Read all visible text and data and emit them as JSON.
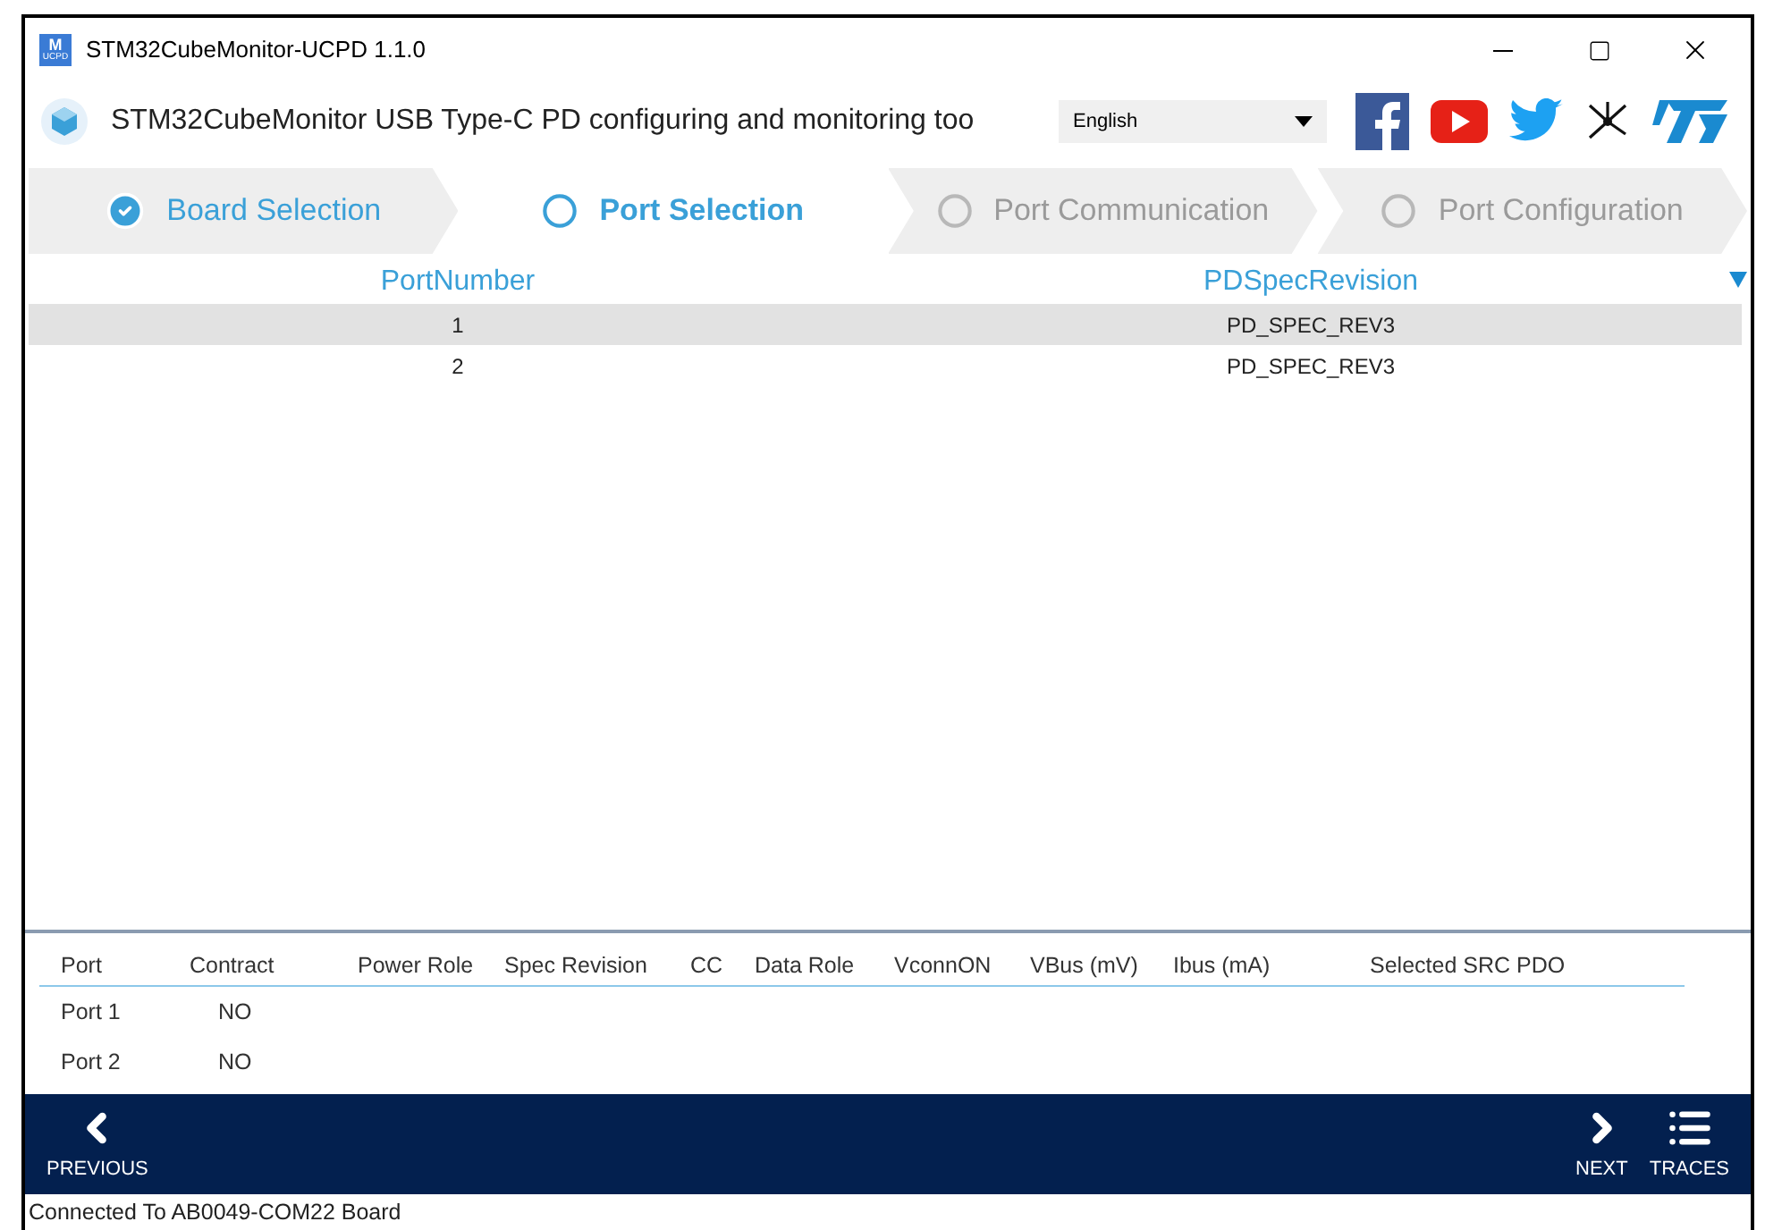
{
  "window": {
    "title": "STM32CubeMonitor-UCPD 1.1.0",
    "app_icon_text": "M",
    "app_icon_sub": "UCPD"
  },
  "header": {
    "title": "STM32CubeMonitor USB Type-C PD configuring and monitoring too",
    "language": "English"
  },
  "steps": [
    {
      "label": "Board Selection",
      "checked": true,
      "disabled": false,
      "selected": false
    },
    {
      "label": "Port Selection",
      "checked": false,
      "disabled": false,
      "selected": true
    },
    {
      "label": "Port Communication",
      "checked": false,
      "disabled": true,
      "selected": false
    },
    {
      "label": "Port Configuration",
      "checked": false,
      "disabled": true,
      "selected": false
    }
  ],
  "port_table": {
    "columns": [
      "PortNumber",
      "PDSpecRevision"
    ],
    "rows": [
      {
        "cells": [
          "1",
          "PD_SPEC_REV3"
        ],
        "selected": true
      },
      {
        "cells": [
          "2",
          "PD_SPEC_REV3"
        ],
        "selected": false
      }
    ]
  },
  "status_table": {
    "columns": [
      "Port",
      "Contract",
      "Power Role",
      "Spec Revision",
      "CC",
      "Data Role",
      "VconnON",
      "VBus (mV)",
      "Ibus (mA)",
      "Selected SRC PDO"
    ],
    "rows": [
      {
        "cells": [
          "Port 1",
          "NO"
        ]
      },
      {
        "cells": [
          "Port 2",
          "NO"
        ]
      }
    ]
  },
  "nav": {
    "previous": "PREVIOUS",
    "next": "NEXT",
    "traces": "TRACES"
  },
  "status_bar": "Connected To AB0049-COM22 Board"
}
